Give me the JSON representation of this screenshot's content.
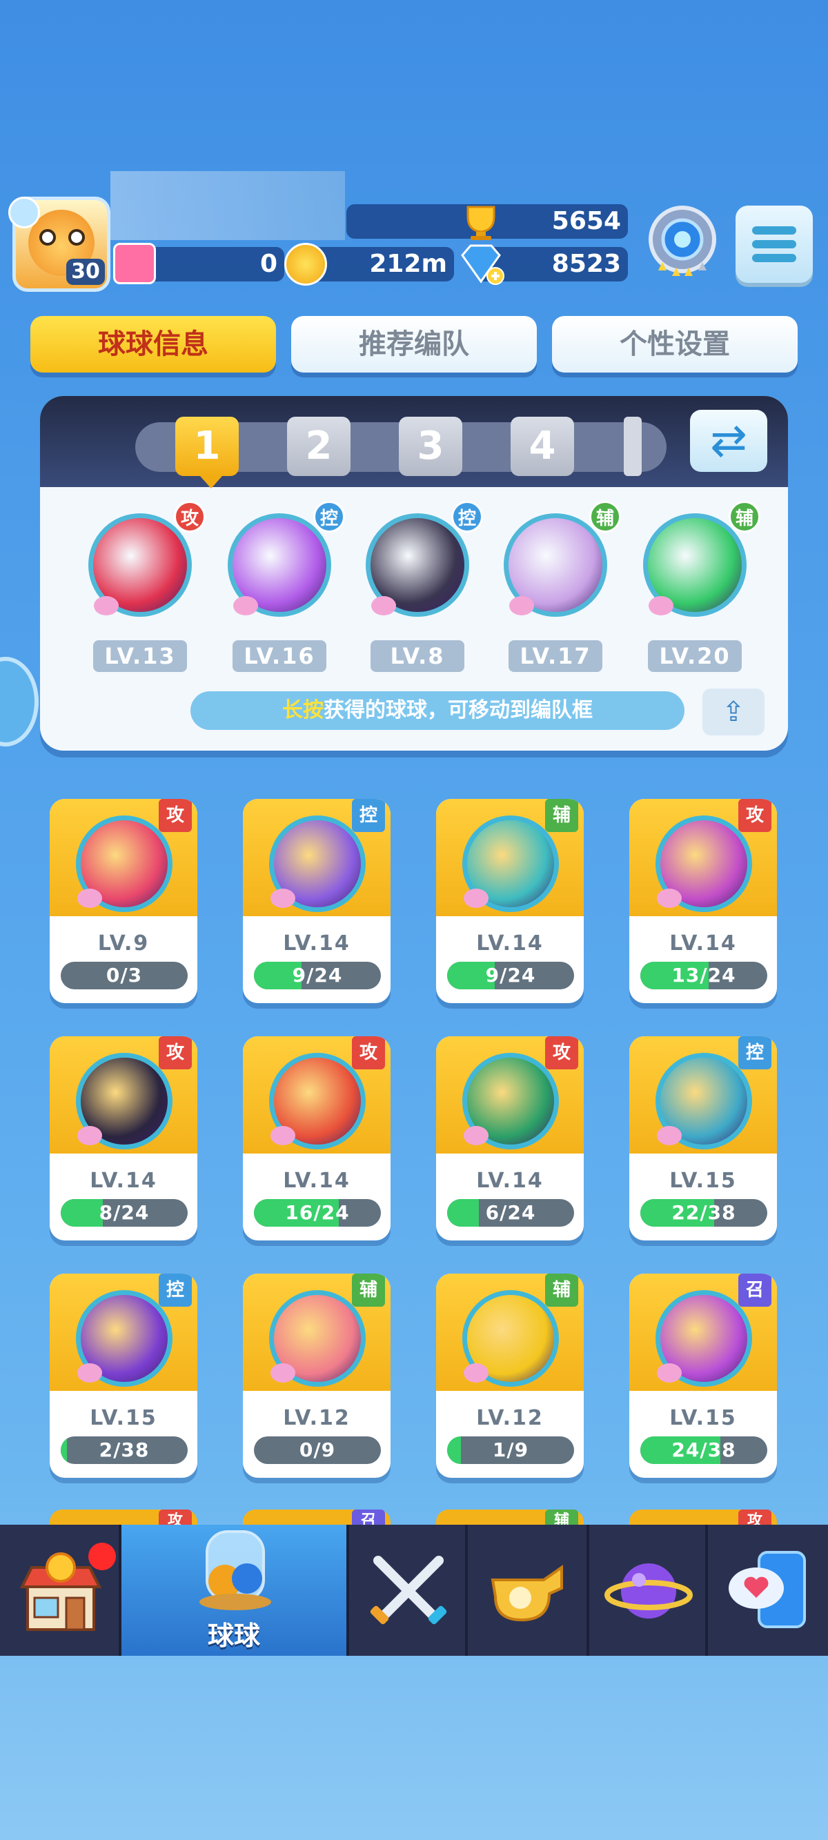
{
  "header": {
    "player_level": "30",
    "trophies": "5654",
    "tickets": "0",
    "coins": "212m",
    "gems": "8523"
  },
  "tabs": [
    {
      "label": "球球信息",
      "active": true
    },
    {
      "label": "推荐编队",
      "active": false
    },
    {
      "label": "个性设置",
      "active": false
    }
  ],
  "team": {
    "slots": [
      "1",
      "2",
      "3",
      "4"
    ],
    "selected_slot": "1",
    "members": [
      {
        "level": "LV.13",
        "tag": "攻",
        "tag_color": "#e4473e",
        "orb_color": "#e0324f",
        "icon": "dinosaur-icon"
      },
      {
        "level": "LV.16",
        "tag": "控",
        "tag_color": "#3f9be0",
        "orb_color": "#b05ce8",
        "icon": "butterfly-icon"
      },
      {
        "level": "LV.8",
        "tag": "控",
        "tag_color": "#3f9be0",
        "orb_color": "#3a3550",
        "icon": "demon-face-icon"
      },
      {
        "level": "LV.17",
        "tag": "辅",
        "tag_color": "#4db048",
        "orb_color": "#c9a2e6",
        "icon": "figures-icon"
      },
      {
        "level": "LV.20",
        "tag": "辅",
        "tag_color": "#4db048",
        "orb_color": "#36c96a",
        "icon": "star-arrow-icon"
      }
    ],
    "hint_highlight": "长按",
    "hint_rest": "获得的球球，可移动到编队框"
  },
  "collection": [
    {
      "level": "LV.9",
      "progress": "0/3",
      "fraction": 0.0,
      "tag": "攻",
      "tag_color": "#e4473e",
      "orb_color": "#e8476c",
      "icon": "burst-icon"
    },
    {
      "level": "LV.14",
      "progress": "9/24",
      "fraction": 0.375,
      "tag": "控",
      "tag_color": "#3f9be0",
      "orb_color": "#8a5ee0",
      "icon": "book-icon"
    },
    {
      "level": "LV.14",
      "progress": "9/24",
      "fraction": 0.375,
      "tag": "辅",
      "tag_color": "#4db048",
      "orb_color": "#3fbcc0",
      "icon": "dragon-icon"
    },
    {
      "level": "LV.14",
      "progress": "13/24",
      "fraction": 0.54,
      "tag": "攻",
      "tag_color": "#e4473e",
      "orb_color": "#c24ec8",
      "icon": "prism-icon"
    },
    {
      "level": "LV.14",
      "progress": "8/24",
      "fraction": 0.33,
      "tag": "攻",
      "tag_color": "#e4473e",
      "orb_color": "#2b2540",
      "icon": "venom-icon"
    },
    {
      "level": "LV.14",
      "progress": "16/24",
      "fraction": 0.67,
      "tag": "攻",
      "tag_color": "#e4473e",
      "orb_color": "#e8503a",
      "icon": "fire-bird-icon"
    },
    {
      "level": "LV.14",
      "progress": "6/24",
      "fraction": 0.25,
      "tag": "攻",
      "tag_color": "#e4473e",
      "orb_color": "#2ca068",
      "icon": "trident-icon"
    },
    {
      "level": "LV.15",
      "progress": "22/38",
      "fraction": 0.58,
      "tag": "控",
      "tag_color": "#3f9be0",
      "orb_color": "#3fa9c8",
      "icon": "whirlwind-icon"
    },
    {
      "level": "LV.15",
      "progress": "2/38",
      "fraction": 0.05,
      "tag": "控",
      "tag_color": "#3f9be0",
      "orb_color": "#7b3fd0",
      "icon": "rune-icon"
    },
    {
      "level": "LV.12",
      "progress": "0/9",
      "fraction": 0.0,
      "tag": "辅",
      "tag_color": "#4db048",
      "orb_color": "#f07c8c",
      "icon": "gift-icon"
    },
    {
      "level": "LV.12",
      "progress": "1/9",
      "fraction": 0.11,
      "tag": "辅",
      "tag_color": "#4db048",
      "orb_color": "#f3c620",
      "icon": "piggy-bank-icon"
    },
    {
      "level": "LV.15",
      "progress": "24/38",
      "fraction": 0.63,
      "tag": "召",
      "tag_color": "#6a5be0",
      "orb_color": "#b84fd8",
      "icon": "phoenix-icon"
    }
  ],
  "peek_tags": [
    {
      "tag": "攻",
      "tag_color": "#e4473e"
    },
    {
      "tag": "召",
      "tag_color": "#6a5be0"
    },
    {
      "tag": "辅",
      "tag_color": "#4db048"
    },
    {
      "tag": "攻",
      "tag_color": "#e4473e"
    }
  ],
  "nav": [
    {
      "name": "shop",
      "icon": "shop-icon",
      "label": ""
    },
    {
      "name": "balls",
      "icon": "ball-jar-icon",
      "label": "球球"
    },
    {
      "name": "battle",
      "icon": "crossed-swords-icon",
      "label": ""
    },
    {
      "name": "whistle",
      "icon": "whistle-icon",
      "label": ""
    },
    {
      "name": "planet",
      "icon": "planet-icon",
      "label": ""
    },
    {
      "name": "social",
      "icon": "chat-heart-icon",
      "label": ""
    }
  ]
}
